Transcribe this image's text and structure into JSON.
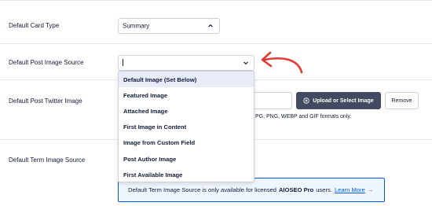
{
  "settings": {
    "card_type": {
      "label": "Default Card Type",
      "value": "Summary"
    },
    "post_image_source": {
      "label": "Default Post Image Source",
      "value": "",
      "options": [
        "Default Image (Set Below)",
        "Featured Image",
        "Attached Image",
        "First Image in Content",
        "Image from Custom Field",
        "Post Author Image",
        "First Available Image"
      ],
      "highlighted_index": 0
    },
    "twitter_image": {
      "label": "Default Post Twitter Image",
      "upload_label": "Upload or Select Image",
      "remove_label": "Remove",
      "hint_text": "PG, PNG, WEBP and GIF formats only."
    },
    "term_image_source": {
      "label": "Default Term Image Source",
      "notice_text": "Default Term Image Source is only available for licensed",
      "notice_product": "AIOSEO Pro",
      "notice_suffix": "users.",
      "notice_link": "Learn More",
      "notice_arrow": "→"
    }
  },
  "colors": {
    "text": "#141b38",
    "accent_blue": "#005ae0",
    "upload_button_bg": "#434960",
    "dropdown_highlight": "#e8ecf8",
    "annotation_red": "#e53935"
  }
}
